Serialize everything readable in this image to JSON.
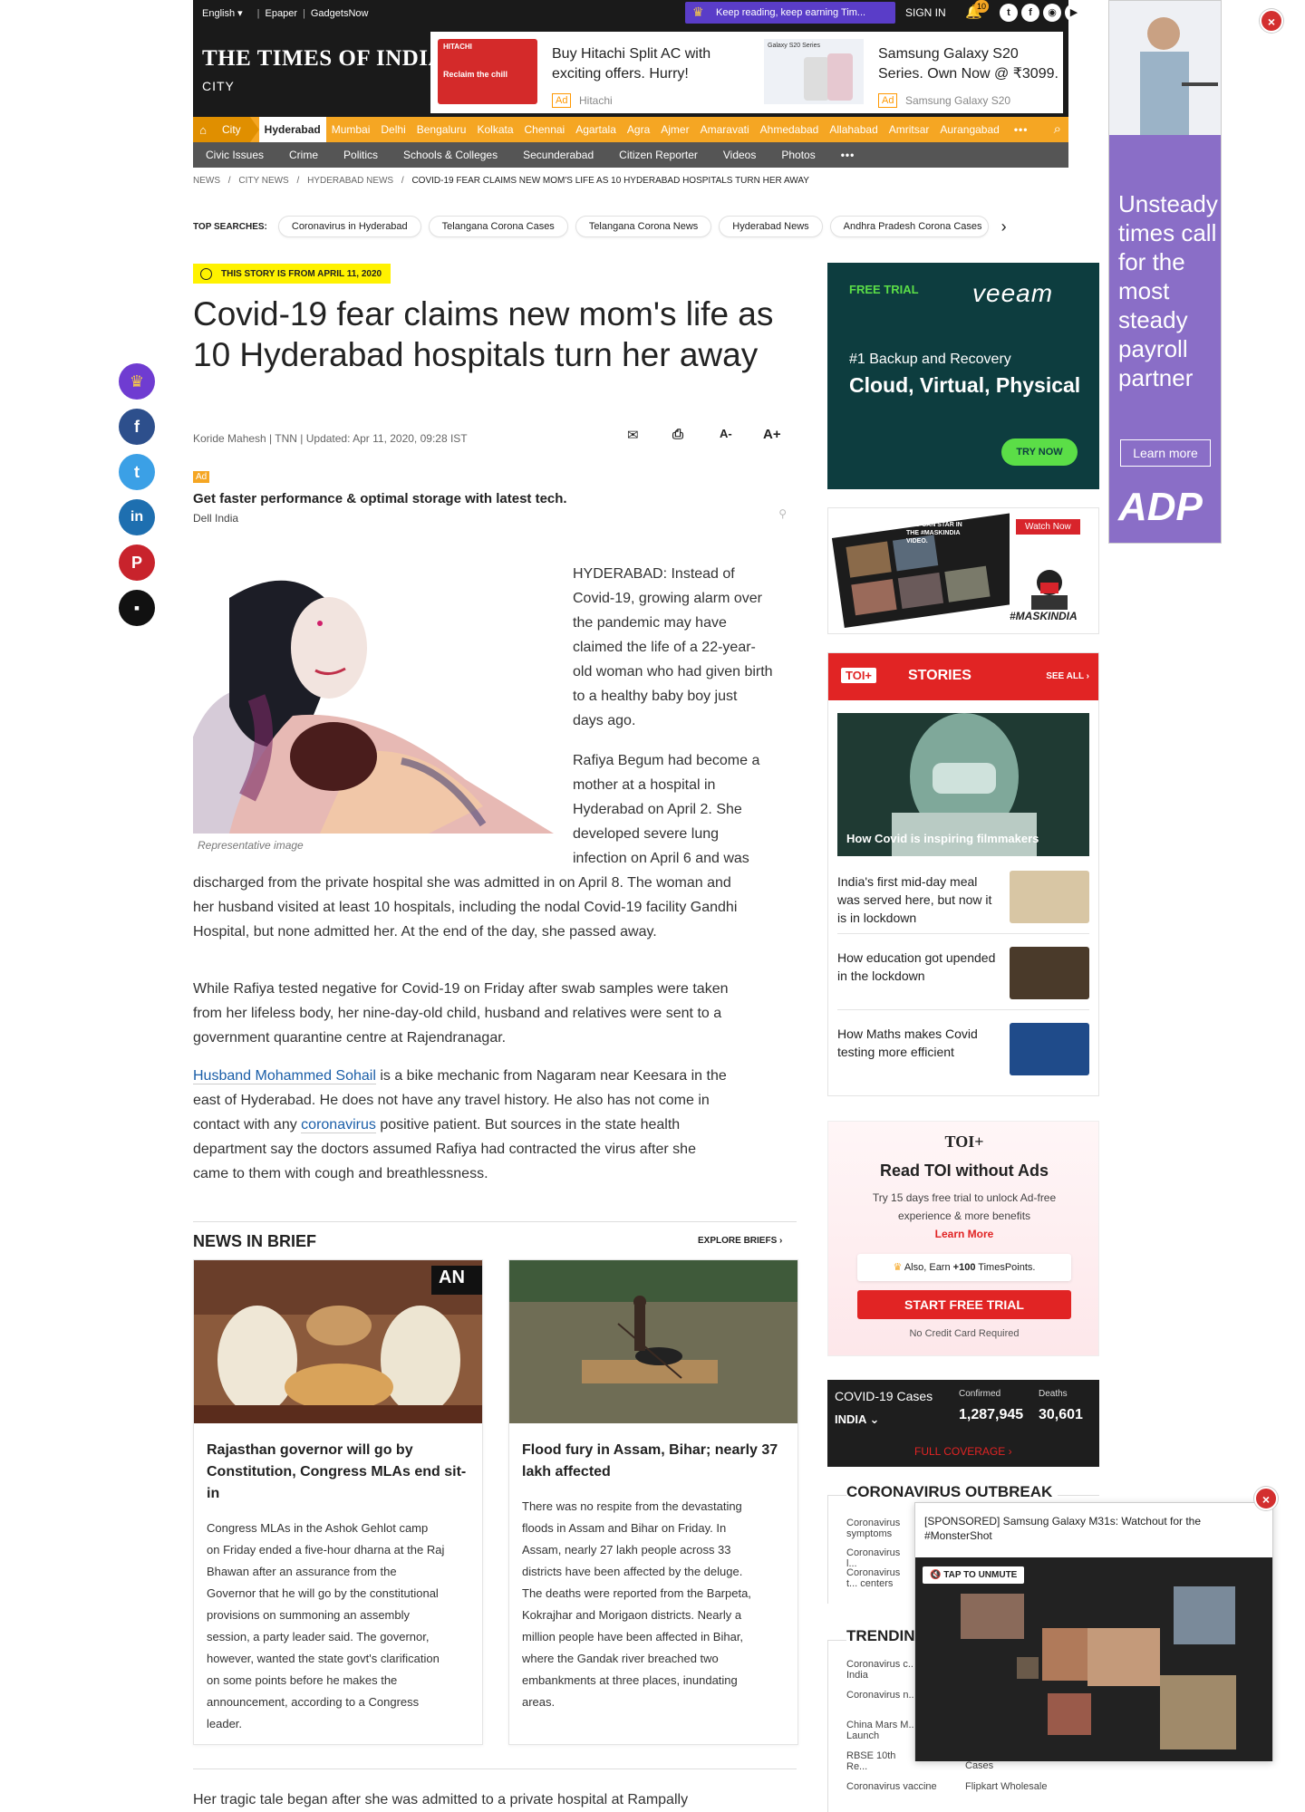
{
  "topbar": {
    "lang": "English",
    "epaper": "Epaper",
    "gadgetsnow": "GadgetsNow",
    "keep_reading": "Keep reading, keep earning Tim...",
    "signin": "SIGN IN",
    "badge": "10"
  },
  "header": {
    "logo": "THE TIMES OF INDIA",
    "section": "CITY",
    "ad1": {
      "title": "Buy Hitachi Split AC with exciting offers. Hurry!",
      "label": "Ad",
      "source": "Hitachi",
      "img_brand": "HITACHI",
      "img_text": "Reclaim the chill"
    },
    "ad2": {
      "title": "Samsung Galaxy S20 Series. Own Now @ ₹3099.",
      "label": "Ad",
      "source": "Samsung Galaxy S20",
      "img_text": "Galaxy S20 Series"
    }
  },
  "citynav": {
    "city": "City",
    "active": "Hyderabad",
    "items": [
      "Mumbai",
      "Delhi",
      "Bengaluru",
      "Kolkata",
      "Chennai",
      "Agartala",
      "Agra",
      "Ajmer",
      "Amaravati",
      "Ahmedabad",
      "Allahabad",
      "Amritsar",
      "Aurangabad"
    ],
    "more": "•••"
  },
  "subnav": {
    "items": [
      "Civic Issues",
      "Crime",
      "Politics",
      "Schools & Colleges",
      "Secunderabad",
      "Citizen Reporter",
      "Videos",
      "Photos"
    ],
    "more": "•••"
  },
  "breadcrumb": [
    "NEWS",
    "/",
    "CITY NEWS",
    "/",
    "HYDERABAD NEWS",
    "/",
    "COVID-19 FEAR CLAIMS NEW MOM'S LIFE AS 10 HYDERABAD HOSPITALS TURN HER AWAY"
  ],
  "top_searches": {
    "label": "TOP SEARCHES:",
    "items": [
      "Coronavirus in Hyderabad",
      "Telangana Corona Cases",
      "Telangana Corona News",
      "Hyderabad News",
      "Andhra Pradesh Corona Cases"
    ]
  },
  "article": {
    "story_date": "THIS STORY IS FROM APRIL 11, 2020",
    "headline": "Covid-19 fear claims new mom's life as 10 Hyderabad hospitals turn her away",
    "byline": "Koride Mahesh | TNN | Updated: Apr 11, 2020, 09:28 IST",
    "tool_font_down": "A-",
    "tool_font_up": "A+",
    "ad": {
      "label": "Ad",
      "title": "Get faster performance & optimal storage with latest tech.",
      "source": "Dell India"
    },
    "caption": "Representative image",
    "p1_lines": [
      "HYDERABAD: Instead of",
      "Covid-19, growing alarm over",
      "the pandemic may have",
      "claimed the life of a 22-year-",
      "old woman who had given birth",
      "to a healthy baby boy just",
      "days ago."
    ],
    "p2_lines": [
      "Rafiya Begum had become a",
      "mother at a hospital in",
      "Hyderabad on April 2. She",
      "developed severe lung",
      "infection on April 6 and was"
    ],
    "p2_rest": [
      "discharged from the private hospital she was admitted in on April 8. The woman and",
      "her husband visited at least 10 hospitals, including the nodal Covid-19 facility Gandhi",
      "Hospital, but none admitted her. At the end of the day, she passed away."
    ],
    "p3_lines": [
      "While Rafiya tested negative for Covid-19 on Friday after swab samples were taken",
      "from her lifeless body, her nine-day-old child, husband and relatives were sent to a",
      "government quarantine centre at Rajendranagar."
    ],
    "p4_link": "Husband Mohammed Sohail",
    "p4_a": " is a bike mechanic from Nagaram near Keesara in the",
    "p4_b": "east of Hyderabad. He does not have any travel history. He also has not come in",
    "p4_c1": "contact with any ",
    "p4_link2": "coronavirus",
    "p4_c2": " positive patient. But sources in the state health",
    "p4_d": "department say the doctors assumed Rafiya had contracted the virus after she",
    "p4_e": "came to them with cough and breathlessness.",
    "bottom": "Her tragic tale began after she was admitted to a private hospital at Rampally"
  },
  "nib": {
    "title": "NEWS IN BRIEF",
    "explore": "EXPLORE BRIEFS",
    "cards": [
      {
        "title": "Rajasthan governor will go by Constitution, Congress MLAs end sit-in",
        "lines": [
          "Congress MLAs in the Ashok Gehlot camp",
          "on Friday ended a five-hour dharna at the Raj",
          "Bhawan after an assurance from the",
          "Governor that he will go by the constitutional",
          "provisions on summoning an assembly",
          "session, a party leader said. The governor,",
          "however, wanted the state govt's clarification",
          "on some points before he makes the",
          "announcement, according to a Congress",
          "leader."
        ]
      },
      {
        "title": "Flood fury in Assam, Bihar; nearly 37 lakh affected",
        "lines": [
          "There was no respite from the devastating",
          "floods in Assam and Bihar on Friday. In",
          "Assam, nearly 27 lakh people across 33",
          "districts have been affected by the deluge.",
          "The deaths were reported from the Barpeta,",
          "Kokrajhar and Morigaon districts. Nearly a",
          "million people have been affected in Bihar,",
          "where the Gandak river breached two",
          "embankments at three places, inundating",
          "areas."
        ]
      }
    ]
  },
  "sidebar": {
    "veeam": {
      "trial": "FREE TRIAL",
      "logo": "veeam",
      "line1": "#1 Backup and Recovery",
      "line2": "Cloud, Virtual, Physical",
      "cta": "TRY NOW"
    },
    "mask": {
      "watch": "Watch Now",
      "tag": "#MASKINDIA",
      "clip_text": "YOU CAN STAR IN THE #MASKINDIA VIDEO."
    },
    "stories": {
      "badge": "TOI+",
      "title": "STORIES",
      "see_all": "SEE ALL ›",
      "big": "How Covid is inspiring filmmakers",
      "items": [
        "India's first mid-day meal was served here, but now it is in lockdown",
        "How education got upended in the lockdown",
        "How Maths makes Covid testing more efficient"
      ]
    },
    "toiplus": {
      "logo": "TOI+",
      "heading": "Read TOI without Ads",
      "desc": "Try 15 days free trial to unlock Ad-free experience & more benefits",
      "learn": "Learn More",
      "earn_pre": "Also, Earn ",
      "earn_num": "+100",
      "earn_post": " TimesPoints.",
      "cta": "START FREE TRIAL",
      "note": "No Credit Card Required"
    },
    "covid": {
      "label": "COVID-19 Cases",
      "country": "INDIA",
      "confirmed_label": "Confirmed",
      "confirmed": "1,287,945",
      "deaths_label": "Deaths",
      "deaths": "30,601",
      "full": "FULL COVERAGE ›"
    },
    "outbreak": {
      "title": "CORONAVIRUS OUTBREAK",
      "items": [
        "Coronavirus symptoms",
        "Coronavirus l...",
        "Coronavirus t... centers"
      ]
    },
    "trending": {
      "title": "TRENDIN...",
      "left": [
        "Coronavirus c... India",
        "Coronavirus n...",
        "China Mars M... Launch",
        "RBSE 10th Re...",
        "Coronavirus vaccine"
      ],
      "right": [
        "Cases",
        "Flipkart Wholesale"
      ]
    }
  },
  "adp": {
    "text": "Unsteady times call for the most steady payroll partner",
    "cta": "Learn more",
    "logo": "ADP"
  },
  "video": {
    "title": "[SPONSORED] Samsung Galaxy M31s: Watchout for the #MonsterShot",
    "unmute": "TAP TO UNMUTE"
  }
}
